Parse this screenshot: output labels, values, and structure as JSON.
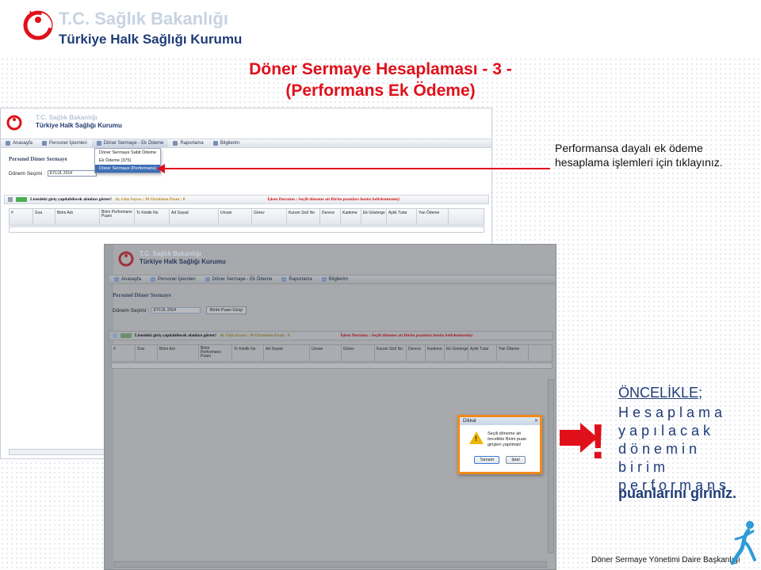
{
  "header": {
    "org_title": "T.C. Sağlık Bakanlığı",
    "org_subtitle": "Türkiye Halk Sağlığı Kurumu",
    "slide_title_line1": "Döner Sermaye Hesaplaması - 3 -",
    "slide_title_line2": "(Performans Ek Ödeme)"
  },
  "app": {
    "mini_title": "T.C. Sağlık Bakanlığı",
    "mini_subtitle": "Türkiye Halk Sağlığı Kurumu",
    "nav": [
      "Anasayfa",
      "Personel İşlemleri",
      "Döner Sermaye - Ek Ödeme",
      "Raporlama",
      "Bilgilerim"
    ],
    "dropdown": [
      "Döner Sermaye Sabit Ödeme",
      "Ek Ödeme (375)",
      "Döner Sermaye (Performans)"
    ],
    "page_title": "Personel Döner Sermaye",
    "period_label": "Dönem Seçimi :",
    "period_value": "EYLÜL 2014",
    "puan_button": "Birim Puan Girişi",
    "toolbar_text": "Listedeki giriş yapılabilecek alanları göster!",
    "toolbar_gun": "Ay Gün Sayısı : 30 Ortalama Puan : 0",
    "toolbar_status": "İşlem Durumu : Seçili döneme ait Birim puanları henüz belirlenmemiş!",
    "columns": [
      "#",
      "Sıra",
      "Birim Adı",
      "Birim Performans Puanı",
      "Tc Kimlik No",
      "Ad Soyad",
      "Unvan",
      "Görev",
      "Kurum Sicil No",
      "Derece",
      "Kademe",
      "Ek Gösterge",
      "Aylık Tutar",
      "Yan Ödeme"
    ]
  },
  "dialog": {
    "title": "Dikkat",
    "message": "Seçili döneme ait öncelikle Birim puan girişleri yapılmalı!",
    "ok": "Tamam",
    "cancel": "İptal"
  },
  "note1": "Performansa dayalı ek ödeme hesaplama işlemleri için tıklayınız.",
  "note2": {
    "head": "ÖNCELİKLE;",
    "body": "Hesaplama yapılacak dönemin birim performans",
    "tail": "puanlarını giriniz."
  },
  "footer": "Döner Sermaye Yönetimi Daire Başkanlığı",
  "colors": {
    "accent_red": "#e0101a",
    "navy": "#1f3c78",
    "dialog_border": "#f08a1a"
  }
}
